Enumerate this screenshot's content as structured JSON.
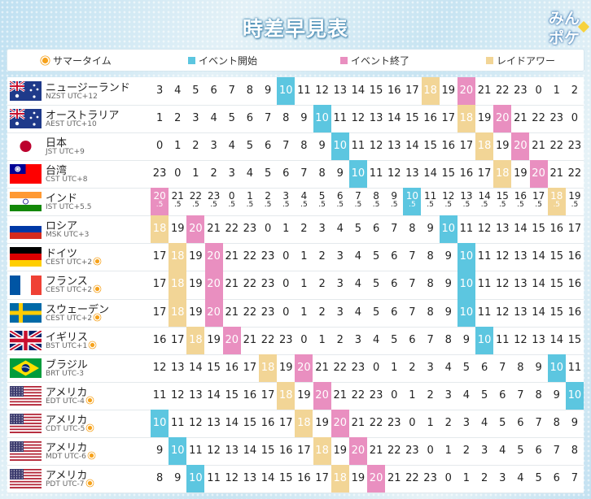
{
  "title": "時差早見表",
  "logo": {
    "line1": "みん",
    "line2": "ポケ"
  },
  "legend": [
    {
      "kind": "sun",
      "label": "サマータイム"
    },
    {
      "kind": "swatch",
      "color": "#5cc6e0",
      "label": "イベント開始"
    },
    {
      "kind": "swatch",
      "color": "#e98fc0",
      "label": "イベント終了"
    },
    {
      "kind": "swatch",
      "color": "#f2d596",
      "label": "レイドアワー"
    }
  ],
  "colors": {
    "start": "#5cc6e0",
    "end": "#e98fc0",
    "raid": "#f2d596"
  },
  "rows": [
    {
      "flag": "au",
      "name": "ニュージーランド",
      "zone": "NZST UTC+12",
      "dst": false,
      "half": false,
      "values": [
        3,
        4,
        5,
        6,
        7,
        8,
        9,
        10,
        11,
        12,
        13,
        14,
        15,
        16,
        17,
        18,
        19,
        20,
        21,
        22,
        23,
        0,
        1,
        2
      ]
    },
    {
      "flag": "au",
      "name": "オーストラリア",
      "zone": "AEST UTC+10",
      "dst": false,
      "half": false,
      "values": [
        1,
        2,
        3,
        4,
        5,
        6,
        7,
        8,
        9,
        10,
        11,
        12,
        13,
        14,
        15,
        16,
        17,
        18,
        19,
        20,
        21,
        22,
        23,
        0
      ]
    },
    {
      "flag": "jp",
      "name": "日本",
      "zone": "JST UTC+9",
      "dst": false,
      "half": false,
      "values": [
        0,
        1,
        2,
        3,
        4,
        5,
        6,
        7,
        8,
        9,
        10,
        11,
        12,
        13,
        14,
        15,
        16,
        17,
        18,
        19,
        20,
        21,
        22,
        23
      ]
    },
    {
      "flag": "tw",
      "name": "台湾",
      "zone": "CST UTC+8",
      "dst": false,
      "half": false,
      "values": [
        23,
        0,
        1,
        2,
        3,
        4,
        5,
        6,
        7,
        8,
        9,
        10,
        11,
        12,
        13,
        14,
        15,
        16,
        17,
        18,
        19,
        20,
        21,
        22
      ]
    },
    {
      "flag": "in",
      "name": "インド",
      "zone": "IST UTC+5.5",
      "dst": false,
      "half": true,
      "values": [
        20,
        21,
        22,
        23,
        0,
        1,
        2,
        3,
        4,
        5,
        6,
        7,
        8,
        9,
        10,
        11,
        12,
        13,
        14,
        15,
        16,
        17,
        18,
        19
      ]
    },
    {
      "flag": "ru",
      "name": "ロシア",
      "zone": "MSK UTC+3",
      "dst": false,
      "half": false,
      "values": [
        18,
        19,
        20,
        21,
        22,
        23,
        0,
        1,
        2,
        3,
        4,
        5,
        6,
        7,
        8,
        9,
        10,
        11,
        12,
        13,
        14,
        15,
        16,
        17
      ]
    },
    {
      "flag": "de",
      "name": "ドイツ",
      "zone": "CEST UTC+2",
      "dst": true,
      "half": false,
      "values": [
        17,
        18,
        19,
        20,
        21,
        22,
        23,
        0,
        1,
        2,
        3,
        4,
        5,
        6,
        7,
        8,
        9,
        10,
        11,
        12,
        13,
        14,
        15,
        16
      ]
    },
    {
      "flag": "fr",
      "name": "フランス",
      "zone": "CEST UTC+2",
      "dst": true,
      "half": false,
      "values": [
        17,
        18,
        19,
        20,
        21,
        22,
        23,
        0,
        1,
        2,
        3,
        4,
        5,
        6,
        7,
        8,
        9,
        10,
        11,
        12,
        13,
        14,
        15,
        16
      ]
    },
    {
      "flag": "se",
      "name": "スウェーデン",
      "zone": "CEST UTC+2",
      "dst": true,
      "half": false,
      "values": [
        17,
        18,
        19,
        20,
        21,
        22,
        23,
        0,
        1,
        2,
        3,
        4,
        5,
        6,
        7,
        8,
        9,
        10,
        11,
        12,
        13,
        14,
        15,
        16
      ]
    },
    {
      "flag": "gb",
      "name": "イギリス",
      "zone": "BST UTC+1",
      "dst": true,
      "half": false,
      "values": [
        16,
        17,
        18,
        19,
        20,
        21,
        22,
        23,
        0,
        1,
        2,
        3,
        4,
        5,
        6,
        7,
        8,
        9,
        10,
        11,
        12,
        13,
        14,
        15
      ]
    },
    {
      "flag": "br",
      "name": "ブラジル",
      "zone": "BRT UTC-3",
      "dst": false,
      "half": false,
      "values": [
        12,
        13,
        14,
        15,
        16,
        17,
        18,
        19,
        20,
        21,
        22,
        23,
        0,
        1,
        2,
        3,
        4,
        5,
        6,
        7,
        8,
        9,
        10,
        11
      ]
    },
    {
      "flag": "us",
      "name": "アメリカ",
      "zone": "EDT UTC-4",
      "dst": true,
      "half": false,
      "values": [
        11,
        12,
        13,
        14,
        15,
        16,
        17,
        18,
        19,
        20,
        21,
        22,
        23,
        0,
        1,
        2,
        3,
        4,
        5,
        6,
        7,
        8,
        9,
        10
      ]
    },
    {
      "flag": "us",
      "name": "アメリカ",
      "zone": "CDT UTC-5",
      "dst": true,
      "half": false,
      "values": [
        10,
        11,
        12,
        13,
        14,
        15,
        16,
        17,
        18,
        19,
        20,
        21,
        22,
        23,
        0,
        1,
        2,
        3,
        4,
        5,
        6,
        7,
        8,
        9
      ]
    },
    {
      "flag": "us",
      "name": "アメリカ",
      "zone": "MDT UTC-6",
      "dst": true,
      "half": false,
      "values": [
        9,
        10,
        11,
        12,
        13,
        14,
        15,
        16,
        17,
        18,
        19,
        20,
        21,
        22,
        23,
        0,
        1,
        2,
        3,
        4,
        5,
        6,
        7,
        8
      ]
    },
    {
      "flag": "us",
      "name": "アメリカ",
      "zone": "PDT UTC-7",
      "dst": true,
      "half": false,
      "values": [
        8,
        9,
        10,
        11,
        12,
        13,
        14,
        15,
        16,
        17,
        18,
        19,
        20,
        21,
        22,
        23,
        0,
        1,
        2,
        3,
        4,
        5,
        6,
        7
      ]
    }
  ]
}
